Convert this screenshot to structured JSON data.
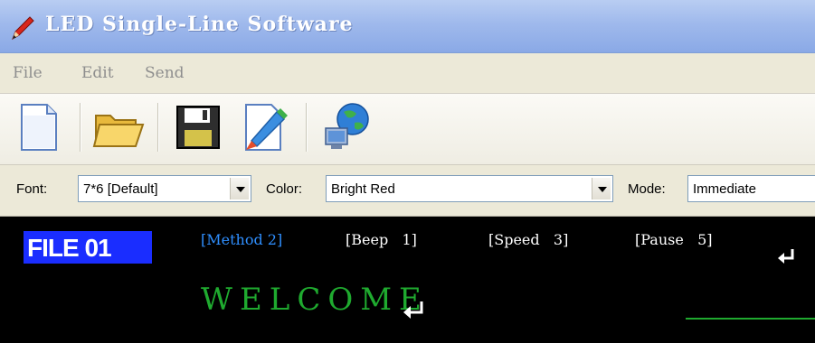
{
  "window": {
    "title": "LED Single-Line Software"
  },
  "menu": [
    "File",
    "Edit",
    "Send"
  ],
  "toolbar": {
    "buttons": [
      "new-file-icon",
      "open-folder-icon",
      "save-disk-icon",
      "edit-brush-icon",
      "send-network-icon"
    ]
  },
  "options": {
    "font_label": "Font:",
    "font_value": "7*6 [Default]",
    "color_label": "Color:",
    "color_value": "Bright Red",
    "mode_label": "Mode:",
    "mode_value": "Immediate"
  },
  "editor": {
    "file_label": "FILE 01",
    "method": "[Method 2]",
    "beep": "[Beep   1]",
    "speed": "[Speed   3]",
    "pause": "[Pause   5]",
    "message": "WELCOME"
  },
  "colors": {
    "accent_blue": "#1a2dff",
    "text_green": "#1faa2f",
    "param_blue": "#2f8fff"
  }
}
